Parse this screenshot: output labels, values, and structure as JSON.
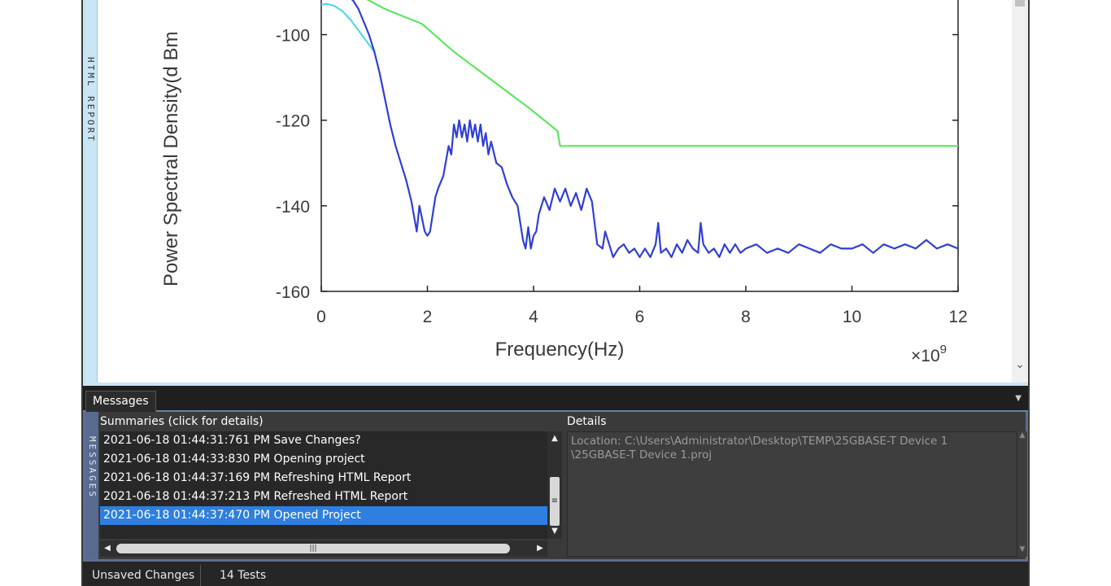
{
  "report": {
    "sidetab_label": "HTML REPORT"
  },
  "chart_data": {
    "type": "line",
    "xlabel": "Frequency(Hz)",
    "ylabel": "Power Spectral Density(d Bm",
    "x_multiplier": "×10",
    "x_multiplier_exp": "9",
    "xlim": [
      0,
      12
    ],
    "ylim": [
      -160,
      -90
    ],
    "xticks": [
      0,
      2,
      4,
      6,
      8,
      10,
      12
    ],
    "yticks": [
      -160,
      -140,
      -120,
      -100
    ],
    "grid": false,
    "series": [
      {
        "color": "#5ee65e",
        "x": [
          0.6,
          1.2,
          1.9,
          2.5,
          3.2,
          3.9,
          4.45,
          4.5,
          5.5,
          7,
          9,
          11,
          12
        ],
        "y": [
          -90,
          -94,
          -97.5,
          -104,
          -110.5,
          -117,
          -122.5,
          -126,
          -126,
          -126,
          -126,
          -126,
          -126
        ]
      },
      {
        "color": "#52d8ee",
        "x": [
          0.0,
          0.1,
          0.25,
          0.4,
          0.55,
          0.7,
          0.85,
          1.0
        ],
        "y": [
          -93,
          -92.8,
          -93.3,
          -94.5,
          -96.5,
          -99,
          -101.5,
          -104
        ]
      },
      {
        "color": "#2f3fd6",
        "x": [
          0.4,
          0.5,
          0.6,
          0.7,
          0.8,
          0.9,
          1.0,
          1.1,
          1.2,
          1.3,
          1.4,
          1.5,
          1.6,
          1.7,
          1.8,
          1.85,
          1.9,
          1.95,
          2.0,
          2.05,
          2.1,
          2.15,
          2.2,
          2.3,
          2.4,
          2.45,
          2.5,
          2.55,
          2.6,
          2.65,
          2.7,
          2.75,
          2.8,
          2.85,
          2.9,
          2.95,
          3.0,
          3.05,
          3.1,
          3.15,
          3.2,
          3.3,
          3.4,
          3.5,
          3.6,
          3.7,
          3.8,
          3.85,
          3.9,
          3.95,
          4.0,
          4.05,
          4.1,
          4.2,
          4.3,
          4.4,
          4.5,
          4.6,
          4.7,
          4.8,
          4.9,
          5.0,
          5.1,
          5.2,
          5.3,
          5.35,
          5.4,
          5.5,
          5.6,
          5.7,
          5.8,
          5.9,
          6.0,
          6.1,
          6.2,
          6.3,
          6.35,
          6.4,
          6.5,
          6.6,
          6.7,
          6.8,
          6.9,
          7.0,
          7.1,
          7.15,
          7.2,
          7.3,
          7.4,
          7.5,
          7.6,
          7.7,
          7.8,
          7.9,
          8.0,
          8.2,
          8.4,
          8.6,
          8.8,
          9.0,
          9.2,
          9.4,
          9.6,
          9.8,
          10.0,
          10.2,
          10.4,
          10.6,
          10.8,
          11.0,
          11.2,
          11.4,
          11.6,
          11.8,
          12.0
        ],
        "y": [
          -90,
          -91,
          -92,
          -94,
          -97,
          -100,
          -104,
          -109,
          -115,
          -121,
          -126,
          -130,
          -134,
          -139,
          -146,
          -140,
          -143,
          -146,
          -147,
          -146,
          -142,
          -138,
          -136,
          -133,
          -126,
          -128,
          -121,
          -124,
          -120,
          -124,
          -121,
          -125,
          -120,
          -124,
          -121,
          -125,
          -121,
          -126,
          -123,
          -128,
          -125,
          -130,
          -131,
          -135,
          -138,
          -140,
          -148,
          -150,
          -145,
          -150,
          -147,
          -146,
          -142,
          -138,
          -141,
          -136,
          -139,
          -136,
          -140,
          -137,
          -141,
          -136,
          -139,
          -149,
          -150,
          -146,
          -148,
          -152,
          -150,
          -149,
          -151,
          -150,
          -152,
          -150,
          -152,
          -149,
          -144,
          -151,
          -150,
          -152,
          -149,
          -151,
          -148,
          -150,
          -151,
          -144,
          -149,
          -151,
          -150,
          -152,
          -149,
          -151,
          -149,
          -151,
          -150,
          -149,
          -151,
          -150,
          -151,
          -149,
          -150,
          -151,
          -149,
          -150,
          -150,
          -149,
          -151,
          -149,
          -150,
          -149,
          -150,
          -148,
          -150,
          -149,
          -150
        ]
      }
    ]
  },
  "messages": {
    "tab_label": "Messages",
    "sidetab_label": "MESSAGES",
    "summaries_header": "Summaries (click for details)",
    "details_header": "Details",
    "rows": [
      {
        "text": "2021-06-18 01:44:31:761 PM Save Changes?"
      },
      {
        "text": "2021-06-18 01:44:33:830 PM Opening project"
      },
      {
        "text": "2021-06-18 01:44:37:169 PM Refreshing HTML Report"
      },
      {
        "text": "2021-06-18 01:44:37:213 PM Refreshed HTML Report"
      },
      {
        "text": "2021-06-18 01:44:37:470 PM Opened Project"
      }
    ],
    "details_line1": "Location: C:\\Users\\Administrator\\Desktop\\TEMP\\25GBASE-T Device 1",
    "details_line2": "\\25GBASE-T Device 1.proj"
  },
  "status": {
    "unsaved": "Unsaved Changes",
    "tests": "14 Tests"
  }
}
